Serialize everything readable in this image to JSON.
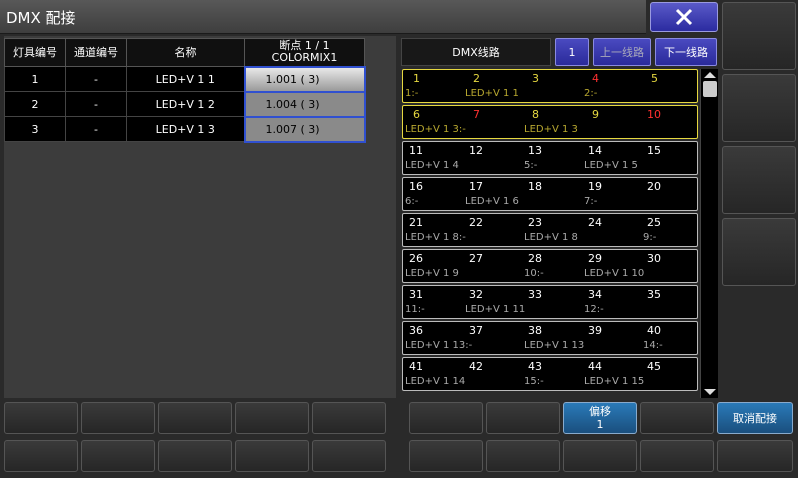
{
  "window": {
    "title": "DMX 配接"
  },
  "fixture_table": {
    "headers": [
      "灯具编号",
      "通道编号",
      "名称",
      "断点 1 / 1",
      "COLORMIX1"
    ],
    "rows": [
      {
        "fixture": "1",
        "channel": "-",
        "name": "LED+V 1 1",
        "address": "1.001 (  3)"
      },
      {
        "fixture": "2",
        "channel": "-",
        "name": "LED+V 1 2",
        "address": "1.004 (  3)"
      },
      {
        "fixture": "3",
        "channel": "-",
        "name": "LED+V 1 3",
        "address": "1.007 (  3)"
      }
    ]
  },
  "dmx_panel": {
    "header": "DMX线路",
    "line_number": "1",
    "prev_label": "上一线路",
    "next_label": "下一线路"
  },
  "dmx_rows": [
    {
      "nums": [
        "1",
        "2",
        "3",
        "4",
        "5"
      ],
      "labels": [
        "1:-",
        "LED+V 1 1",
        "2:-"
      ]
    },
    {
      "nums": [
        "6",
        "7",
        "8",
        "9",
        "10"
      ],
      "labels": [
        "LED+V 1 3:-",
        "LED+V 1 3"
      ]
    },
    {
      "nums": [
        "11",
        "12",
        "13",
        "14",
        "15"
      ],
      "labels": [
        "LED+V 1 4",
        "5:-",
        "LED+V 1 5"
      ]
    },
    {
      "nums": [
        "16",
        "17",
        "18",
        "19",
        "20"
      ],
      "labels": [
        "6:-",
        "LED+V 1 6",
        "7:-"
      ]
    },
    {
      "nums": [
        "21",
        "22",
        "23",
        "24",
        "25"
      ],
      "labels": [
        "LED+V 1 8:-",
        "LED+V 1 8",
        "9:-"
      ]
    },
    {
      "nums": [
        "26",
        "27",
        "28",
        "29",
        "30"
      ],
      "labels": [
        "LED+V 1 9",
        "10:-",
        "LED+V 1 10"
      ]
    },
    {
      "nums": [
        "31",
        "32",
        "33",
        "34",
        "35"
      ],
      "labels": [
        "11:-",
        "LED+V 1 11",
        "12:-"
      ]
    },
    {
      "nums": [
        "36",
        "37",
        "38",
        "39",
        "40"
      ],
      "labels": [
        "LED+V 1 13:-",
        "LED+V 1 13",
        "14:-"
      ]
    },
    {
      "nums": [
        "41",
        "42",
        "43",
        "44",
        "45"
      ],
      "labels": [
        "LED+V 1 14",
        "15:-",
        "LED+V 1 15"
      ]
    }
  ],
  "bottom": {
    "offset_label": "偏移",
    "offset_value": "1",
    "unpatch_label": "取消配接"
  },
  "colors": {
    "accent_blue": "#3a3ab0",
    "highlight_yellow": "#e6d840",
    "red_channel": "#ff3030"
  }
}
